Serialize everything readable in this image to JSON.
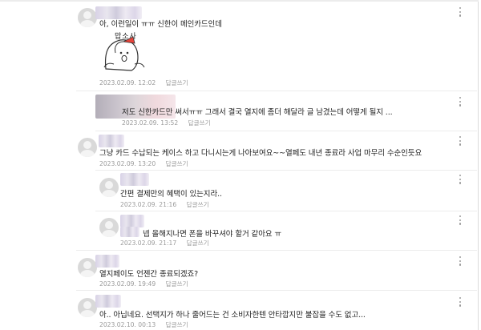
{
  "comments": [
    {
      "text": "아, 이런일이 ㅠㅠ 신한이 메인카드인데",
      "sticker_caption": "맙소사",
      "date": "2023.02.09. 12:02",
      "reply_label": "답글쓰기"
    },
    {
      "text": "저도 신한카드만 써서ㅠㅠ 그래서 결국 열지에 좀더 해달라 글 남겼는데 어떻게 될지 ...",
      "date": "2023.02.09. 13:52",
      "reply_label": "답글쓰기"
    },
    {
      "text": "그냥 카드 수납되는 케이스 하고 다니시는게 나아보여요~~열페도 내년 종료라 사업 마무리 수순인듯요",
      "date": "2023.02.09. 13:20",
      "reply_label": "답글쓰기"
    },
    {
      "text": "간편 결제만의 혜택이 있는지라..",
      "date": "2023.02.09. 21:16",
      "reply_label": "답글쓰기"
    },
    {
      "text": "넵 올해지나면 폰을 바꾸셔야 할거 같아요 ㅠ",
      "date": "2023.02.09. 21:17",
      "reply_label": "답글쓰기"
    },
    {
      "text": "열지페이도 언젠간 종료되겠죠?",
      "date": "2023.02.09. 19:49",
      "reply_label": "답글쓰기"
    },
    {
      "text": "아.. 아닙네요. 선택지가 하나 줄어드는 건 소비자한텐 안타깝지만 불잡을 수도 없고...",
      "date": "2023.02.10. 00:13",
      "reply_label": "답글쓰기"
    }
  ]
}
